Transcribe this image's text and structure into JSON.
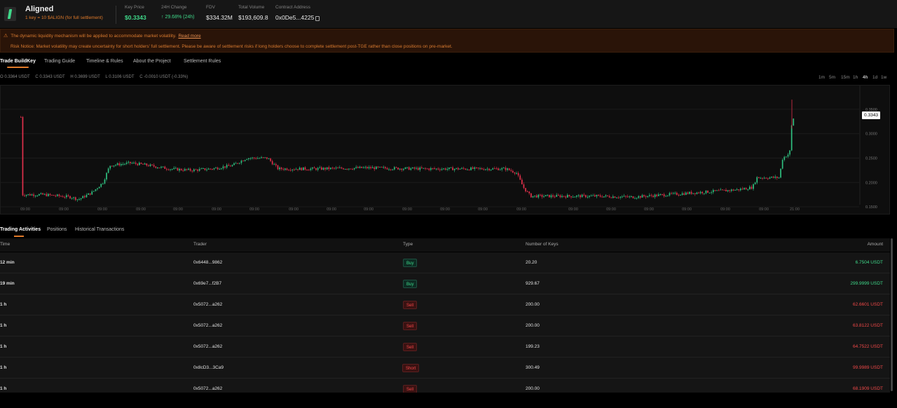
{
  "header": {
    "title": "Aligned",
    "subtitle": "1 key = 10 $ALIGN (for full settlement)",
    "stats": [
      {
        "label": "Key Price",
        "value": "$0.3343",
        "style": "green"
      },
      {
        "label": "24H Change",
        "value": "↑ 29.68% (24h)",
        "style": "green-s"
      },
      {
        "label": "FDV",
        "value": "$334.32M",
        "style": ""
      },
      {
        "label": "Total Volume",
        "value": "$193,609.8",
        "style": ""
      },
      {
        "label": "Contract Address",
        "value": "0x0De5...4225",
        "style": ""
      }
    ]
  },
  "notice": {
    "line1": "The dynamic liquidity mechanism will be applied to accommodate market volatility.",
    "read_more": "Read more",
    "line2": "Risk Notice: Market volatility may create uncertainty for short holders' full settlement. Please be aware of settlement risks if long holders choose to complete settlement post-TGE rather than close positions on pre-market."
  },
  "tabs": [
    "Trade BuildKey",
    "Trading Guide",
    "Timeline & Rules",
    "About the Project",
    "Settlement Rules"
  ],
  "ohlc": {
    "o": "O 0.3364 USDT",
    "c": "C 0.3343 USDT",
    "h": "H 0.3699 USDT",
    "l": "L 0.3106 USDT",
    "chg": "C -0.0010 USDT (-0.33%)"
  },
  "timeframes": [
    "1m",
    "5m",
    "15m",
    "1h",
    "4h",
    "1d",
    "1w"
  ],
  "timeframe_active": "4h",
  "chart": {
    "current_price": "0.3343",
    "y_ticks": [
      "0.3500",
      "0.3000",
      "0.2500",
      "0.2000",
      "0.1500"
    ],
    "x_ticks": [
      "09:00",
      "09:00",
      "09:00",
      "09:00",
      "09:00",
      "09:00",
      "09:00",
      "09:00",
      "09:00",
      "09:00",
      "09:00",
      "09:00",
      "09:00",
      "09:00",
      "09:00",
      "09:00",
      "09:00",
      "09:00",
      "09:00",
      "09:00",
      "21:00"
    ],
    "colors": {
      "up": "#2fbf7f",
      "down": "#e0304a"
    }
  },
  "activity_tabs": [
    "Trading Activities",
    "Positions",
    "Historical Transactions"
  ],
  "table": {
    "headers": {
      "time": "Time",
      "trader": "Trader",
      "type": "Type",
      "keys": "Number of Keys",
      "amount": "Amount"
    },
    "rows": [
      {
        "time": "12 min",
        "trader": "0x6448...9862",
        "type": "Buy",
        "kind": "buy",
        "keys": "20.20",
        "amount": "6.7504 USDT"
      },
      {
        "time": "19 min",
        "trader": "0x69e7...f2B7",
        "type": "Buy",
        "kind": "buy",
        "keys": "929.67",
        "amount": "299.9999 USDT"
      },
      {
        "time": "1 h",
        "trader": "0x5072...a262",
        "type": "Sell",
        "kind": "sell",
        "keys": "200.00",
        "amount": "62.6601 USDT"
      },
      {
        "time": "1 h",
        "trader": "0x5072...a262",
        "type": "Sell",
        "kind": "sell",
        "keys": "200.00",
        "amount": "63.8122 USDT"
      },
      {
        "time": "1 h",
        "trader": "0x5072...a262",
        "type": "Sell",
        "kind": "sell",
        "keys": "199.23",
        "amount": "64.7522 USDT"
      },
      {
        "time": "1 h",
        "trader": "0x8cD3...3Ca9",
        "type": "Short",
        "kind": "sell",
        "keys": "300.49",
        "amount": "99.9989 USDT"
      },
      {
        "time": "1 h",
        "trader": "0x5072...a262",
        "type": "Sell",
        "kind": "sell",
        "keys": "200.00",
        "amount": "68.1909 USDT"
      }
    ]
  }
}
